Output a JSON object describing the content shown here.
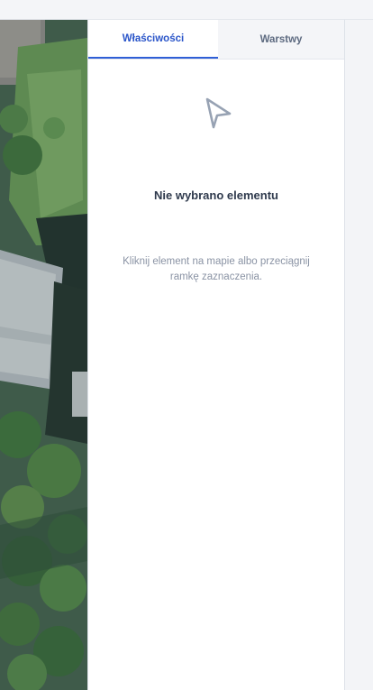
{
  "tabs": [
    {
      "label": "Właściwości",
      "active": true
    },
    {
      "label": "Warstwy",
      "active": false
    }
  ],
  "empty_state": {
    "icon": "cursor-pointer-icon",
    "title": "Nie wybrano elementu",
    "hint": "Kliknij element na mapie albo przeciągnij ramkę zaznaczenia."
  },
  "colors": {
    "accent": "#2f5fd6",
    "active_tab_text": "#2a55c9",
    "inactive_tab_text": "#5d6a80",
    "title_text": "#2f3a4d",
    "hint_text": "#8a93a4",
    "icon_stroke": "#97a2b3"
  }
}
